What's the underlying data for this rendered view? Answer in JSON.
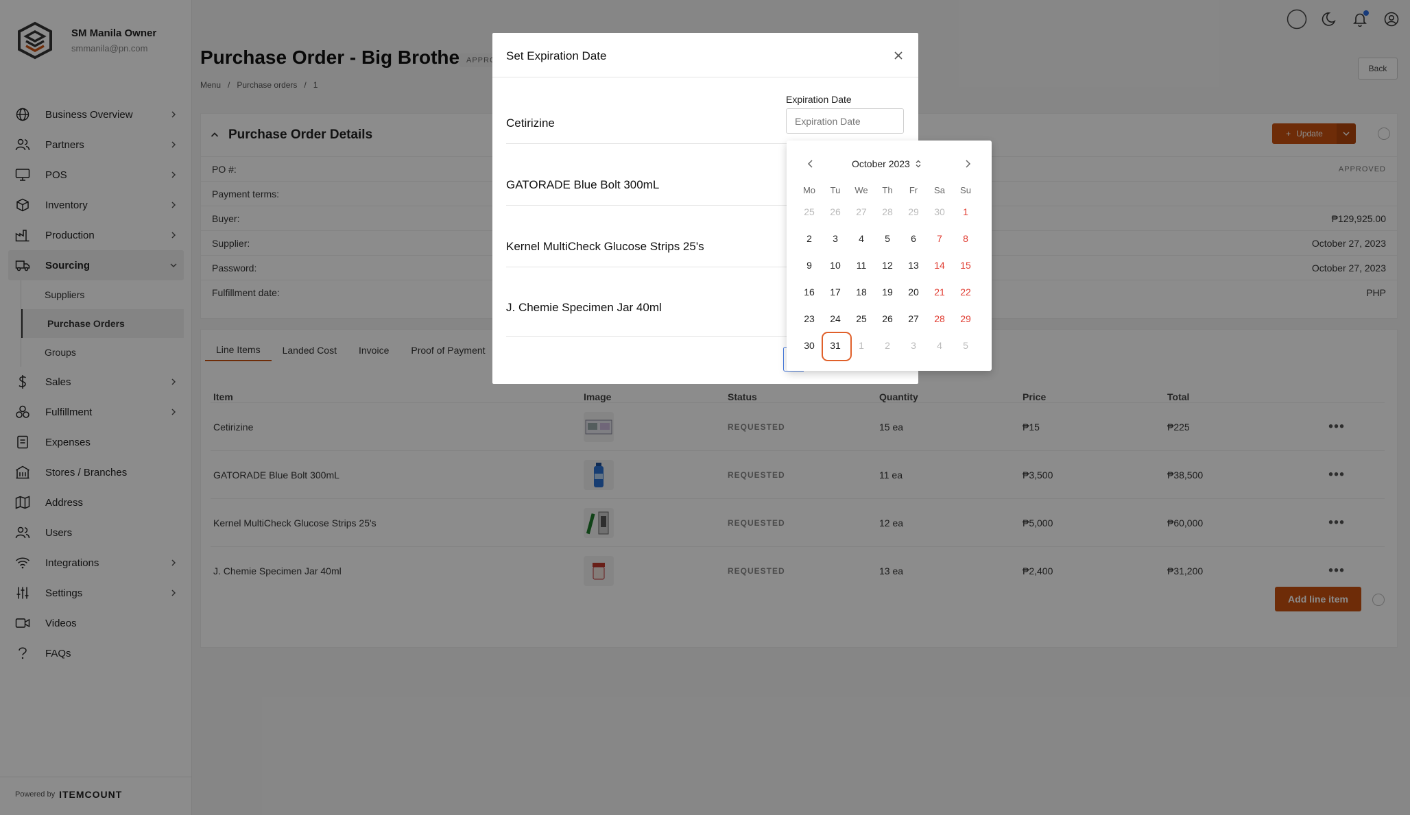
{
  "org": {
    "name": "SM Manila Owner",
    "email": "smmanila@pn.com"
  },
  "sidebar": {
    "items": [
      {
        "label": "Business Overview",
        "has_chevron": true
      },
      {
        "label": "Partners",
        "has_chevron": true
      },
      {
        "label": "POS",
        "has_chevron": true
      },
      {
        "label": "Inventory",
        "has_chevron": true
      },
      {
        "label": "Production",
        "has_chevron": true
      },
      {
        "label": "Sourcing",
        "has_chevron": true,
        "expanded": true
      },
      {
        "label": "Sales",
        "has_chevron": true
      },
      {
        "label": "Fulfillment",
        "has_chevron": true
      },
      {
        "label": "Expenses"
      },
      {
        "label": "Stores / Branches"
      },
      {
        "label": "Address"
      },
      {
        "label": "Users"
      },
      {
        "label": "Integrations",
        "has_chevron": true
      },
      {
        "label": "Settings",
        "has_chevron": true
      },
      {
        "label": "Videos"
      },
      {
        "label": "FAQs"
      }
    ],
    "sourcing_sub": [
      "Suppliers",
      "Purchase Orders",
      "Groups"
    ],
    "powered_by": "Powered by",
    "powered_brand": "ITEMCOUNT"
  },
  "page": {
    "title": "Purchase Order - Big Brother",
    "status_pill": "APPROVED",
    "breadcrumb": [
      "Menu",
      "/",
      "Purchase orders",
      "/",
      "1"
    ],
    "back_label": "Back"
  },
  "details": {
    "title": "Purchase Order Details",
    "update_label": "Update",
    "rows": [
      {
        "label": "PO #:",
        "value": "APPROVED"
      },
      {
        "label": "Payment terms:",
        "value": ""
      },
      {
        "label": "Buyer:",
        "value": "₱129,925.00"
      },
      {
        "label": "Supplier:",
        "value": "October 27, 2023"
      },
      {
        "label": "Password:",
        "value": "October 27, 2023"
      },
      {
        "label": "Fulfillment date:",
        "value": "PHP"
      }
    ]
  },
  "tabs": [
    "Line Items",
    "Landed Cost",
    "Invoice",
    "Proof of Payment"
  ],
  "table": {
    "headers": [
      "Item",
      "Image",
      "Status",
      "Quantity",
      "Price",
      "Total"
    ],
    "rows": [
      {
        "item": "Cetirizine",
        "status": "REQUESTED",
        "quantity": "15 ea",
        "price": "₱15",
        "total": "₱225"
      },
      {
        "item": "GATORADE Blue Bolt 300mL",
        "status": "REQUESTED",
        "quantity": "11 ea",
        "price": "₱3,500",
        "total": "₱38,500"
      },
      {
        "item": "Kernel MultiCheck Glucose Strips 25's",
        "status": "REQUESTED",
        "quantity": "12 ea",
        "price": "₱5,000",
        "total": "₱60,000"
      },
      {
        "item": "J. Chemie Specimen Jar 40ml",
        "status": "REQUESTED",
        "quantity": "13 ea",
        "price": "₱2,400",
        "total": "₱31,200"
      }
    ],
    "add_line_label": "Add line item"
  },
  "modal": {
    "title": "Set Expiration Date",
    "items": [
      "Cetirizine",
      "GATORADE Blue Bolt 300mL",
      "Kernel MultiCheck Glucose Strips 25's",
      "J. Chemie Specimen Jar 40ml"
    ],
    "field_label": "Expiration Date",
    "field_placeholder": "Expiration Date"
  },
  "calendar": {
    "month_label": "October 2023",
    "weekdays": [
      "Mo",
      "Tu",
      "We",
      "Th",
      "Fr",
      "Sa",
      "Su"
    ],
    "weeks": [
      [
        "25",
        "26",
        "27",
        "28",
        "29",
        "30",
        "1"
      ],
      [
        "2",
        "3",
        "4",
        "5",
        "6",
        "7",
        "8"
      ],
      [
        "9",
        "10",
        "11",
        "12",
        "13",
        "14",
        "15"
      ],
      [
        "16",
        "17",
        "18",
        "19",
        "20",
        "21",
        "22"
      ],
      [
        "23",
        "24",
        "25",
        "26",
        "27",
        "28",
        "29"
      ],
      [
        "30",
        "31",
        "1",
        "2",
        "3",
        "4",
        "5"
      ]
    ],
    "today": "31"
  },
  "colors": {
    "accent": "#c8500f",
    "weekend": "#e03a2f",
    "today_ring": "#e0602a"
  }
}
